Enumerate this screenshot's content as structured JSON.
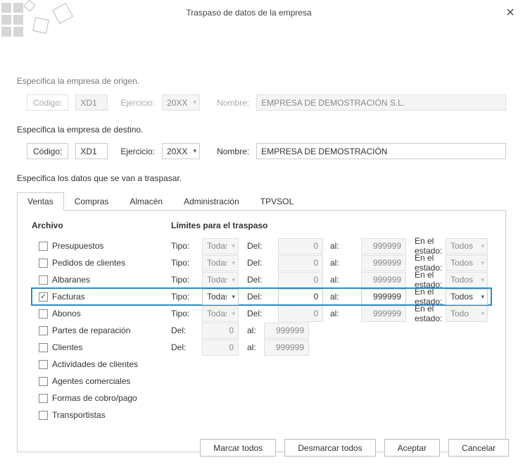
{
  "title": "Traspaso de datos de la empresa",
  "origin": {
    "label": "Especifica la empresa de origen.",
    "codigo_label": "Código:",
    "codigo": "XD1",
    "ejercicio_label": "Ejercicio:",
    "ejercicio": "20XX",
    "nombre_label": "Nombre:",
    "nombre": "EMPRESA DE DEMOSTRACIÓN S.L."
  },
  "dest": {
    "label": "Especifica la empresa de destino.",
    "codigo_label": "Código:",
    "codigo": "XD1",
    "ejercicio_label": "Ejercicio:",
    "ejercicio": "20XX",
    "nombre_label": "Nombre:",
    "nombre": "EMPRESA DE DEMOSTRACIÓN"
  },
  "data_label": "Especifica los datos que se van a traspasar.",
  "tabs": [
    "Ventas",
    "Compras",
    "Almacén",
    "Administración",
    "TPVSOL"
  ],
  "headers": {
    "archive": "Archivo",
    "limits": "Límites para el traspaso"
  },
  "labels": {
    "tipo": "Tipo:",
    "del": "Del:",
    "al": "al:",
    "estado": "En el estado:"
  },
  "items": [
    {
      "name": "Presupuestos",
      "checked": false,
      "tipo": "Todas",
      "del": "0",
      "al": "999999",
      "estado": "Todos",
      "full": true
    },
    {
      "name": "Pedidos de clientes",
      "checked": false,
      "tipo": "Todas",
      "del": "0",
      "al": "999999",
      "estado": "Todos",
      "full": true
    },
    {
      "name": "Albaranes",
      "checked": false,
      "tipo": "Todas",
      "del": "0",
      "al": "999999",
      "estado": "Todos",
      "full": true
    },
    {
      "name": "Facturas",
      "checked": true,
      "tipo": "Todas",
      "del": "0",
      "al": "999999",
      "estado": "Todos",
      "full": true,
      "selected": true
    },
    {
      "name": "Abonos",
      "checked": false,
      "tipo": "Todas",
      "del": "0",
      "al": "999999",
      "estado": "Todo",
      "full": true
    },
    {
      "name": "Partes de reparación",
      "checked": false,
      "del": "0",
      "al": "999999",
      "range_only": true
    },
    {
      "name": "Clientes",
      "checked": false,
      "del": "0",
      "al": "999999",
      "range_only": true
    },
    {
      "name": "Actividades de clientes",
      "checked": false
    },
    {
      "name": "Agentes comerciales",
      "checked": false
    },
    {
      "name": "Formas de cobro/pago",
      "checked": false
    },
    {
      "name": "Transportistas",
      "checked": false
    }
  ],
  "buttons": {
    "mark_all": "Marcar todos",
    "unmark_all": "Desmarcar todos",
    "accept": "Aceptar",
    "cancel": "Cancelar"
  }
}
